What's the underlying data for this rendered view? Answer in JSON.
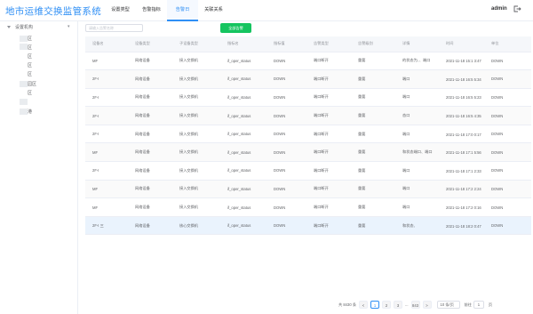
{
  "header": {
    "app_title": "地市运维交换监管系统",
    "user": "admin",
    "nav": [
      {
        "label": "设置类型"
      },
      {
        "label": "告警指标"
      },
      {
        "label": "告警日"
      },
      {
        "label": "关联关系"
      }
    ],
    "active_nav": 2
  },
  "sidebar": {
    "root_label": "设置机构",
    "children": [
      "区",
      "区",
      "区",
      "区",
      "区",
      "园区",
      "区",
      "港"
    ]
  },
  "toolbar": {
    "search_placeholder": "请输入告警名称",
    "confirm_label": "全部告警"
  },
  "table": {
    "columns": [
      "设备名",
      "设备类型",
      "子设备类型",
      "指标名",
      "指标值",
      "告警类型",
      "告警级别",
      "详情",
      "时间",
      "单位"
    ],
    "rows": [
      {
        "name": "MF",
        "type": "网络设备",
        "subtype": "接入交换机",
        "metric": "if_oper_status",
        "value": "DOWN",
        "alarm_type": "端口断开",
        "level": "重要",
        "detail": "的状态为、、端口",
        "time": "2021-11-18 15:1 3:47",
        "unit": "DOWN"
      },
      {
        "name": "2F-I",
        "type": "网络设备",
        "subtype": "接入交换机",
        "metric": "if_oper_status",
        "value": "DOWN",
        "alarm_type": "端口断开",
        "level": "重要",
        "detail": "端口",
        "time": "2021-11-18 16:5 5:34",
        "unit": "DOWN"
      },
      {
        "name": "2F-I",
        "type": "网络设备",
        "subtype": "接入交换机",
        "metric": "if_oper_status",
        "value": "DOWN",
        "alarm_type": "端口断开",
        "level": "重要",
        "detail": "端口",
        "time": "2021-11-18 16:5 5:23",
        "unit": "DOWN"
      },
      {
        "name": "2F-I",
        "type": "网络设备",
        "subtype": "接入交换机",
        "metric": "if_oper_status",
        "value": "DOWN",
        "alarm_type": "端口断开",
        "level": "重要",
        "detail": "态口",
        "time": "2021-11-18 16:5 4:35",
        "unit": "DOWN"
      },
      {
        "name": "2F-I",
        "type": "网络设备",
        "subtype": "接入交换机",
        "metric": "if_oper_status",
        "value": "DOWN",
        "alarm_type": "端口断开",
        "level": "重要",
        "detail": "端口",
        "time": "2021-11-18 17:0 0:17",
        "unit": "DOWN"
      },
      {
        "name": "MF",
        "type": "网络设备",
        "subtype": "接入交换机",
        "metric": "if_oper_status",
        "value": "DOWN",
        "alarm_type": "端口断开",
        "level": "重要",
        "detail": "和状态端口、端口",
        "time": "2021-11-18 17:1 5:56",
        "unit": "DOWN"
      },
      {
        "name": "2F-I",
        "type": "网络设备",
        "subtype": "接入交换机",
        "metric": "if_oper_status",
        "value": "DOWN",
        "alarm_type": "端口断开",
        "level": "重要",
        "detail": "端口",
        "time": "2021-11-18 17:1 2:33",
        "unit": "DOWN"
      },
      {
        "name": "MF",
        "type": "网络设备",
        "subtype": "接入交换机",
        "metric": "if_oper_status",
        "value": "DOWN",
        "alarm_type": "端口断开",
        "level": "重要",
        "detail": "端口",
        "time": "2021-11-18 17:2 2:24",
        "unit": "DOWN"
      },
      {
        "name": "MF",
        "type": "网络设备",
        "subtype": "接入交换机",
        "metric": "if_oper_status",
        "value": "DOWN",
        "alarm_type": "端口断开",
        "level": "重要",
        "detail": "端口",
        "time": "2021-11-18 17:2 0:16",
        "unit": "DOWN"
      },
      {
        "name": "2F-I 三",
        "type": "网络设备",
        "subtype": "核心交换机",
        "metric": "if_oper_status",
        "value": "DOWN",
        "alarm_type": "端口断开",
        "level": "重要",
        "detail": "和状态、",
        "time": "2021-11-18 18:2 0:47",
        "unit": "DOWN"
      }
    ]
  },
  "pager": {
    "total": "共 8430 条",
    "prev": "<",
    "pages": [
      "1",
      "2",
      "3",
      "...",
      "843"
    ],
    "next": ">",
    "page_size": "10 条/页",
    "jump_prefix": "前往",
    "jump_value": "1",
    "jump_suffix": "页"
  },
  "colors": {
    "accent": "#2f8ff5",
    "confirm": "#14c45f"
  }
}
